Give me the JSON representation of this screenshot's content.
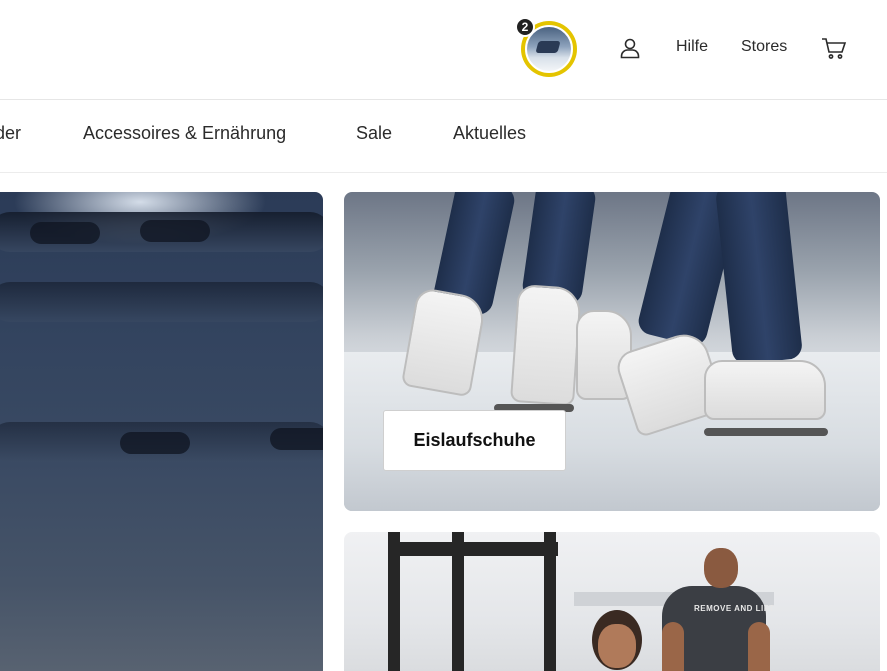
{
  "header": {
    "avatar_badge": "2",
    "links": {
      "help": "Hilfe",
      "stores": "Stores"
    },
    "icons": {
      "account": "user-icon",
      "cart": "cart-icon"
    },
    "accent_color": "#e4c400"
  },
  "nav": {
    "items": [
      {
        "label": "der"
      },
      {
        "label": "Accessoires & Ernährung"
      },
      {
        "label": "Sale"
      },
      {
        "label": "Aktuelles"
      }
    ]
  },
  "tiles": {
    "skates": {
      "button_label": "Eislaufschuhe"
    },
    "gym": {
      "shirt_text": "REMOVE AND LIFT"
    }
  }
}
